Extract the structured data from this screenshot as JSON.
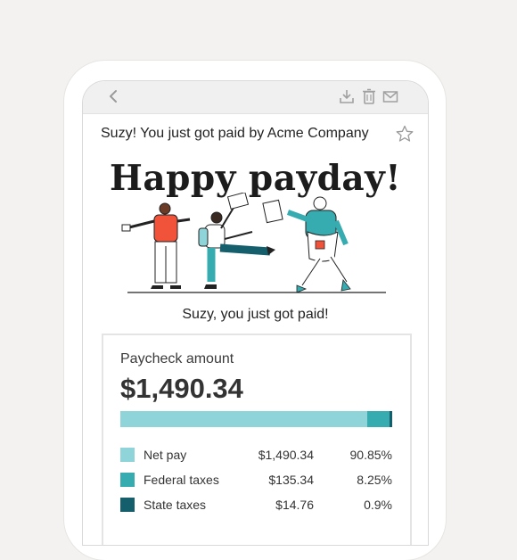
{
  "email": {
    "subject": "Suzy! You just got paid by Acme Company",
    "headline": "Happy payday!",
    "tagline": "Suzy, you just got paid!"
  },
  "toolbar": {
    "icons": [
      "back-icon",
      "download-icon",
      "trash-icon",
      "mail-icon"
    ]
  },
  "paycheck": {
    "label": "Paycheck amount",
    "amount": "$1,490.34",
    "breakdown": [
      {
        "name": "Net pay",
        "amount": "$1,490.34",
        "percent": "90.85%",
        "fraction": 0.9085,
        "color": "#8fd4d9"
      },
      {
        "name": "Federal taxes",
        "amount": "$135.34",
        "percent": "8.25%",
        "fraction": 0.0825,
        "color": "#36abb0"
      },
      {
        "name": "State taxes",
        "amount": "$14.76",
        "percent": "0.9%",
        "fraction": 0.009,
        "color": "#155f6d"
      }
    ]
  },
  "colors": {
    "background": "#f3f2f0",
    "accent_teal": "#36abb0",
    "accent_light": "#8fd4d9",
    "accent_dark": "#155f6d",
    "figure_orange": "#f0533a"
  }
}
